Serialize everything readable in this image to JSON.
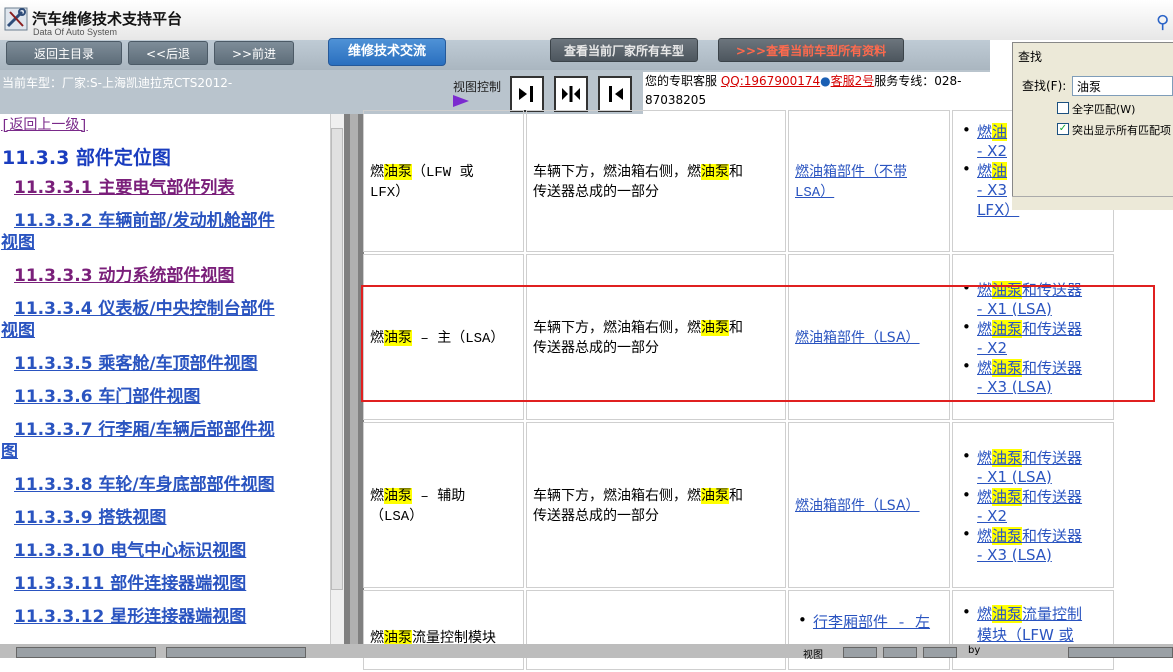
{
  "app": {
    "title": "汽车维修技术支持平台",
    "subtitle": "Data Of Auto System"
  },
  "nav": {
    "home": "返回主目录",
    "back": "<<后退",
    "forward": ">>前进",
    "forum": "维修技术交流",
    "view_all_models": "查看当前厂家所有车型",
    "view_all_data": ">>>查看当前车型所有资料"
  },
  "info": {
    "current_model": "当前车型：厂家:S-上海凯迪拉克CTS2012-",
    "view_control": "视图控制",
    "support_prefix": "您的专职客服",
    "qq": "QQ:1967900174",
    "service2": "客服2号",
    "hotline_label": "服务专线：028-",
    "hotline_number": "87038205"
  },
  "left": {
    "back_up": "[返回上一级]",
    "section_title": "11.3.3 部件定位图",
    "toc": [
      "11.3.3.1 主要电气部件列表",
      "11.3.3.2 车辆前部/发动机舱部件",
      "视图",
      "11.3.3.3 动力系统部件视图",
      "11.3.3.4 仪表板/中央控制台部件",
      "视图",
      "11.3.3.5 乘客舱/车顶部件视图",
      "11.3.3.6 车门部件视图",
      "11.3.3.7 行李厢/车辆后部部件视",
      "图",
      "11.3.3.8 车轮/车身底部部件视图",
      "11.3.3.9 搭铁视图",
      "11.3.3.10 电气中心标识视图",
      "11.3.3.11 部件连接器端视图",
      "11.3.3.12 星形连接器端视图"
    ]
  },
  "table": {
    "row1": {
      "pre": "燃",
      "hl": "油泵",
      "name_rest": "（LFW 或",
      "name_line2": "LFX）",
      "loc_pre": "车辆下方，燃油箱右侧，燃",
      "loc_hl": "油泵",
      "loc_post": "和",
      "loc_line2": "传送器总成的一部分",
      "view": "燃油箱部件（不带",
      "view2": "LSA）",
      "conn1_pre": "燃",
      "conn1_hl": "油",
      "conn1_line2": "- X2",
      "conn2_pre": "燃",
      "conn2_hl": "油",
      "conn2_line2": "- X3",
      "conn2_line3": "LFX）"
    },
    "row2": {
      "pre": "燃",
      "hl": "油泵",
      "name_rest": " – 主（LSA）",
      "loc_pre": "车辆下方，燃油箱右侧，燃",
      "loc_hl": "油泵",
      "loc_post": "和",
      "loc_line2": "传送器总成的一部分",
      "view": "燃油箱部件（LSA）",
      "conn": [
        {
          "pre": "燃",
          "hl": "油泵",
          "post": "和传送器",
          "line2": "- X1 (LSA)"
        },
        {
          "pre": "燃",
          "hl": "油泵",
          "post": "和传送器",
          "line2": "- X2"
        },
        {
          "pre": "燃",
          "hl": "油泵",
          "post": "和传送器",
          "line2": "- X3 (LSA)"
        }
      ]
    },
    "row3": {
      "pre": "燃",
      "hl": "油泵",
      "name_rest": " – 辅助",
      "name_line2": "（LSA）",
      "loc_pre": "车辆下方，燃油箱右侧，燃",
      "loc_hl": "油泵",
      "loc_post": "和",
      "loc_line2": "传送器总成的一部分",
      "view": "燃油箱部件（LSA）",
      "conn": [
        {
          "pre": "燃",
          "hl": "油泵",
          "post": "和传送器",
          "line2": "- X1 (LSA)"
        },
        {
          "pre": "燃",
          "hl": "油泵",
          "post": "和传送器",
          "line2": "- X2"
        },
        {
          "pre": "燃",
          "hl": "油泵",
          "post": "和传送器",
          "line2": "- X3 (LSA)"
        }
      ]
    },
    "row4": {
      "pre": "燃",
      "hl": "油泵",
      "name_rest": "流量控制模块",
      "view": "行李厢部件 - 左",
      "conn_pre": "燃",
      "conn_hl": "油泵",
      "conn_post": "流量控制",
      "conn_line2": "模块（LFW 或"
    }
  },
  "find": {
    "title": "查找",
    "label": "查找(F):",
    "value": "油泵",
    "opt1": "全字匹配(W)",
    "opt1_checked": false,
    "opt2": "突出显示所有匹配项",
    "opt2_checked": true
  },
  "status": {
    "view_label": "视图",
    "by": "by"
  },
  "colors": {
    "highlight": "#ffff00",
    "link": "#2a54c0",
    "visited": "#7a1f7a",
    "annotation_box": "#e02020"
  }
}
